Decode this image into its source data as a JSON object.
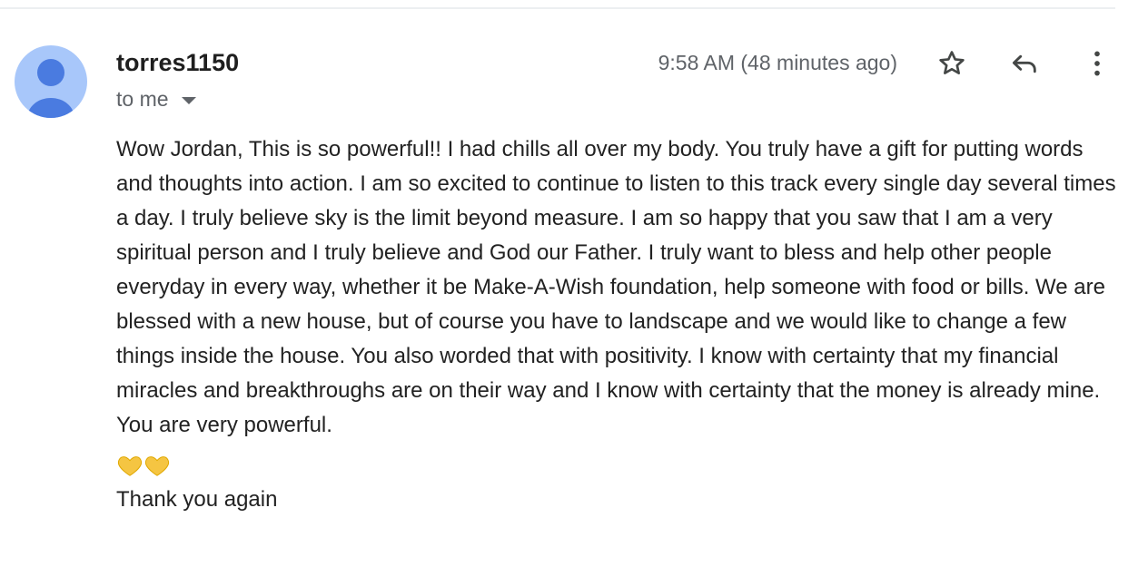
{
  "message": {
    "sender_name": "torres1150",
    "recipient_label": "to me",
    "timestamp": "9:58 AM (48 minutes ago)",
    "body_text": "Wow Jordan, This is so powerful!! I had chills all over my body. You truly have a gift for putting words and thoughts into action. I am so excited to continue to listen to this track every single day several times a day. I truly believe sky is the limit beyond measure. I am so happy that you saw that I am a very spiritual person and I truly believe and God our Father. I truly want to bless and help other people everyday in every way, whether it be Make-A-Wish foundation, help someone with food or bills. We are blessed with a new house, but of course you have to landscape and we would like to change a few things inside the house. You also worded that with positivity. I know with certainty that my financial miracles and breakthroughs are on their way and I know with certainty that the money is already mine. You are very powerful.",
    "emoji": [
      "yellow-heart",
      "yellow-heart"
    ],
    "closing_text": "Thank you again"
  },
  "icons": {
    "avatar": "default-person-avatar",
    "star": "star-outline-icon",
    "reply": "reply-arrow-icon",
    "more": "more-vertical-icon",
    "recipient_dropdown": "caret-down-icon"
  },
  "colors": {
    "avatar_bg": "#a8c7fa",
    "avatar_figure": "#4a7be0",
    "heart": "#f5c542",
    "icon": "#444746"
  }
}
